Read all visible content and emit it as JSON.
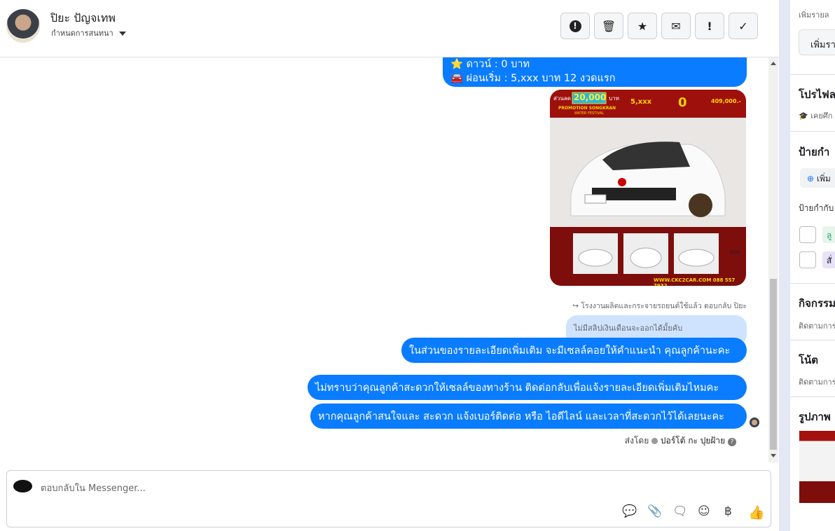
{
  "header": {
    "name": "ปิยะ ปัญจเทพ",
    "subtitle": "กำหนดการสนทนา",
    "toolbar": [
      {
        "icon": "alert-circle-icon",
        "glyph": "!"
      },
      {
        "icon": "trash-icon",
        "glyph": "🗑"
      },
      {
        "icon": "star-icon",
        "glyph": "★"
      },
      {
        "icon": "mail-icon",
        "glyph": "✉"
      },
      {
        "icon": "exclamation-icon",
        "glyph": "!"
      },
      {
        "icon": "check-icon",
        "glyph": "✓"
      }
    ]
  },
  "messages": {
    "partial_lines": [
      "⭐ ดาวน์ : 0 บาท",
      "🚘 ผ่อนเริ่ม : 5,xxx บาท 12 งวดแรก"
    ],
    "image": {
      "discount_label": "ส่วนลด",
      "discount": "20,000",
      "discount_unit": "บาท",
      "promo": "PROMOTION SONGKRAN",
      "promo_sub": "WATER FESTIVAL",
      "installment": "5,xxx",
      "down": "0",
      "price": "409,000.-",
      "code": "K098",
      "footer": "WWW.CKC2CAR.COM 088 557 7932"
    },
    "reply_label": "โรงงานผลิตและกระจายรถยนต์ใช้แล้ว ตอบกลับ ปิยะ",
    "quoted": "ไม่มีสลิปเงินเดือนจะออกได้มั้ยคับ",
    "bubbles": [
      "ในส่วนของรายละเอียดเพิ่มเติม จะมีเซลล์คอยให้คำแนะนำ คุณลูกค้านะคะ",
      "ไม่ทราบว่าคุณลูกค้าสะดวกให้เซลล์ของทางร้าน ติดต่อกลับเพื่อแจ้งรายละเอียดเพิ่มเติมไหมคะ",
      "หากคุณลูกค้าสนใจและ สะดวก แจ้งเบอร์ติดต่อ หรือ ไอดีไลน์ และเวลาที่สะดวกไว้ได้เลยนะคะ"
    ],
    "sent_by_label": "ส่งโดย",
    "sent_by_name": "ปอร์โต้ กะ ปุยฝ้าย"
  },
  "composer": {
    "placeholder": "ตอบกลับใน Messenger...",
    "icons": [
      "saved-reply-icon",
      "attachment-icon",
      "chat-icon",
      "emoji-icon",
      "baht-icon",
      "like-icon"
    ]
  },
  "right_panel": {
    "add_detail_label": "เพิ่มรายล",
    "add_detail_button": "เพิ่มรา",
    "profile_title": "โปรไฟล",
    "profile_sub": "เคยศึก",
    "labels_title": "ป้ายกำ",
    "add_label_button": "เพิ่ม",
    "labels_sub": "ป้ายกำกับ",
    "tags": [
      "ลู",
      "สั่"
    ],
    "activity_title": "กิจกรรม",
    "activity_sub": "ติดตามการ",
    "notes_title": "โน้ต",
    "notes_sub": "ติดตามการ",
    "photos_title": "รูปภาพ"
  },
  "colors": {
    "accent": "#0a7cff",
    "quote": "#cfe3ff"
  }
}
